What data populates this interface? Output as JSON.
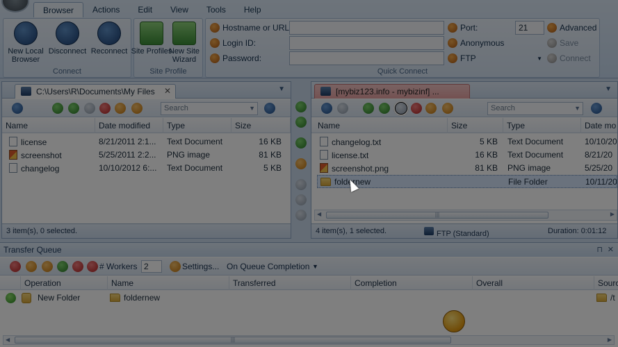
{
  "ribbon": {
    "tabs": [
      "Browser",
      "Actions",
      "Edit",
      "View",
      "Tools",
      "Help"
    ],
    "active_tab": "Browser",
    "connect_group": {
      "label": "Connect",
      "buttons": [
        "New Local Browser",
        "Disconnect",
        "Reconnect"
      ]
    },
    "site_profile_group": {
      "label": "Site Profile",
      "buttons": [
        "Site Profiles",
        "New Site Wizard"
      ]
    },
    "quick_connect": {
      "label": "Quick Connect",
      "hostname_label": "Hostname or URL:",
      "login_label": "Login ID:",
      "password_label": "Password:",
      "port_label": "Port:",
      "port_value": "21",
      "anonymous_label": "Anonymous",
      "protocol_value": "FTP",
      "advanced_label": "Advanced",
      "save_label": "Save",
      "connect_label": "Connect"
    }
  },
  "local_pane": {
    "tab_title": "C:\\Users\\R\\Documents\\My Files",
    "search_placeholder": "Search",
    "columns": [
      "Name",
      "Date modified",
      "Type",
      "Size"
    ],
    "files": [
      {
        "name": "license",
        "date": "8/21/2011 2:1...",
        "type": "Text Document",
        "size": "16 KB",
        "icon": "text-file-icon"
      },
      {
        "name": "screenshot",
        "date": "5/25/2011 2:2...",
        "type": "PNG image",
        "size": "81 KB",
        "icon": "png-file-icon"
      },
      {
        "name": "changelog",
        "date": "10/10/2012 6:...",
        "type": "Text Document",
        "size": "5 KB",
        "icon": "text-file-icon"
      }
    ],
    "status": "3 item(s), 0 selected."
  },
  "remote_pane": {
    "tab_title": "[mybiz123.info - mybizinf] ...",
    "search_placeholder": "Search",
    "columns": [
      "Name",
      "Size",
      "Type",
      "Date mo"
    ],
    "files": [
      {
        "name": "changelog.txt",
        "size": "5 KB",
        "type": "Text Document",
        "date": "10/10/20",
        "icon": "text-file-icon"
      },
      {
        "name": "license.txt",
        "size": "16 KB",
        "type": "Text Document",
        "date": "8/21/20",
        "icon": "text-file-icon"
      },
      {
        "name": "screenshot.png",
        "size": "81 KB",
        "type": "PNG image",
        "date": "5/25/20",
        "icon": "png-file-icon"
      },
      {
        "name": "foldernew",
        "size": "",
        "type": "File Folder",
        "date": "10/11/20",
        "icon": "folder-icon"
      }
    ],
    "status": "4 item(s), 1 selected.",
    "protocol_status": "FTP (Standard)",
    "duration": "Duration: 0:01:12"
  },
  "queue": {
    "title": "Transfer Queue",
    "workers_label": "# Workers",
    "workers_value": "2",
    "settings_label": "Settings...",
    "completion_label": "On Queue Completion",
    "columns": [
      "Operation",
      "Name",
      "Transferred",
      "Completion",
      "Overall",
      "Sourc"
    ],
    "rows": [
      {
        "operation": "New Folder",
        "name": "foldernew",
        "source": "/t"
      }
    ]
  }
}
